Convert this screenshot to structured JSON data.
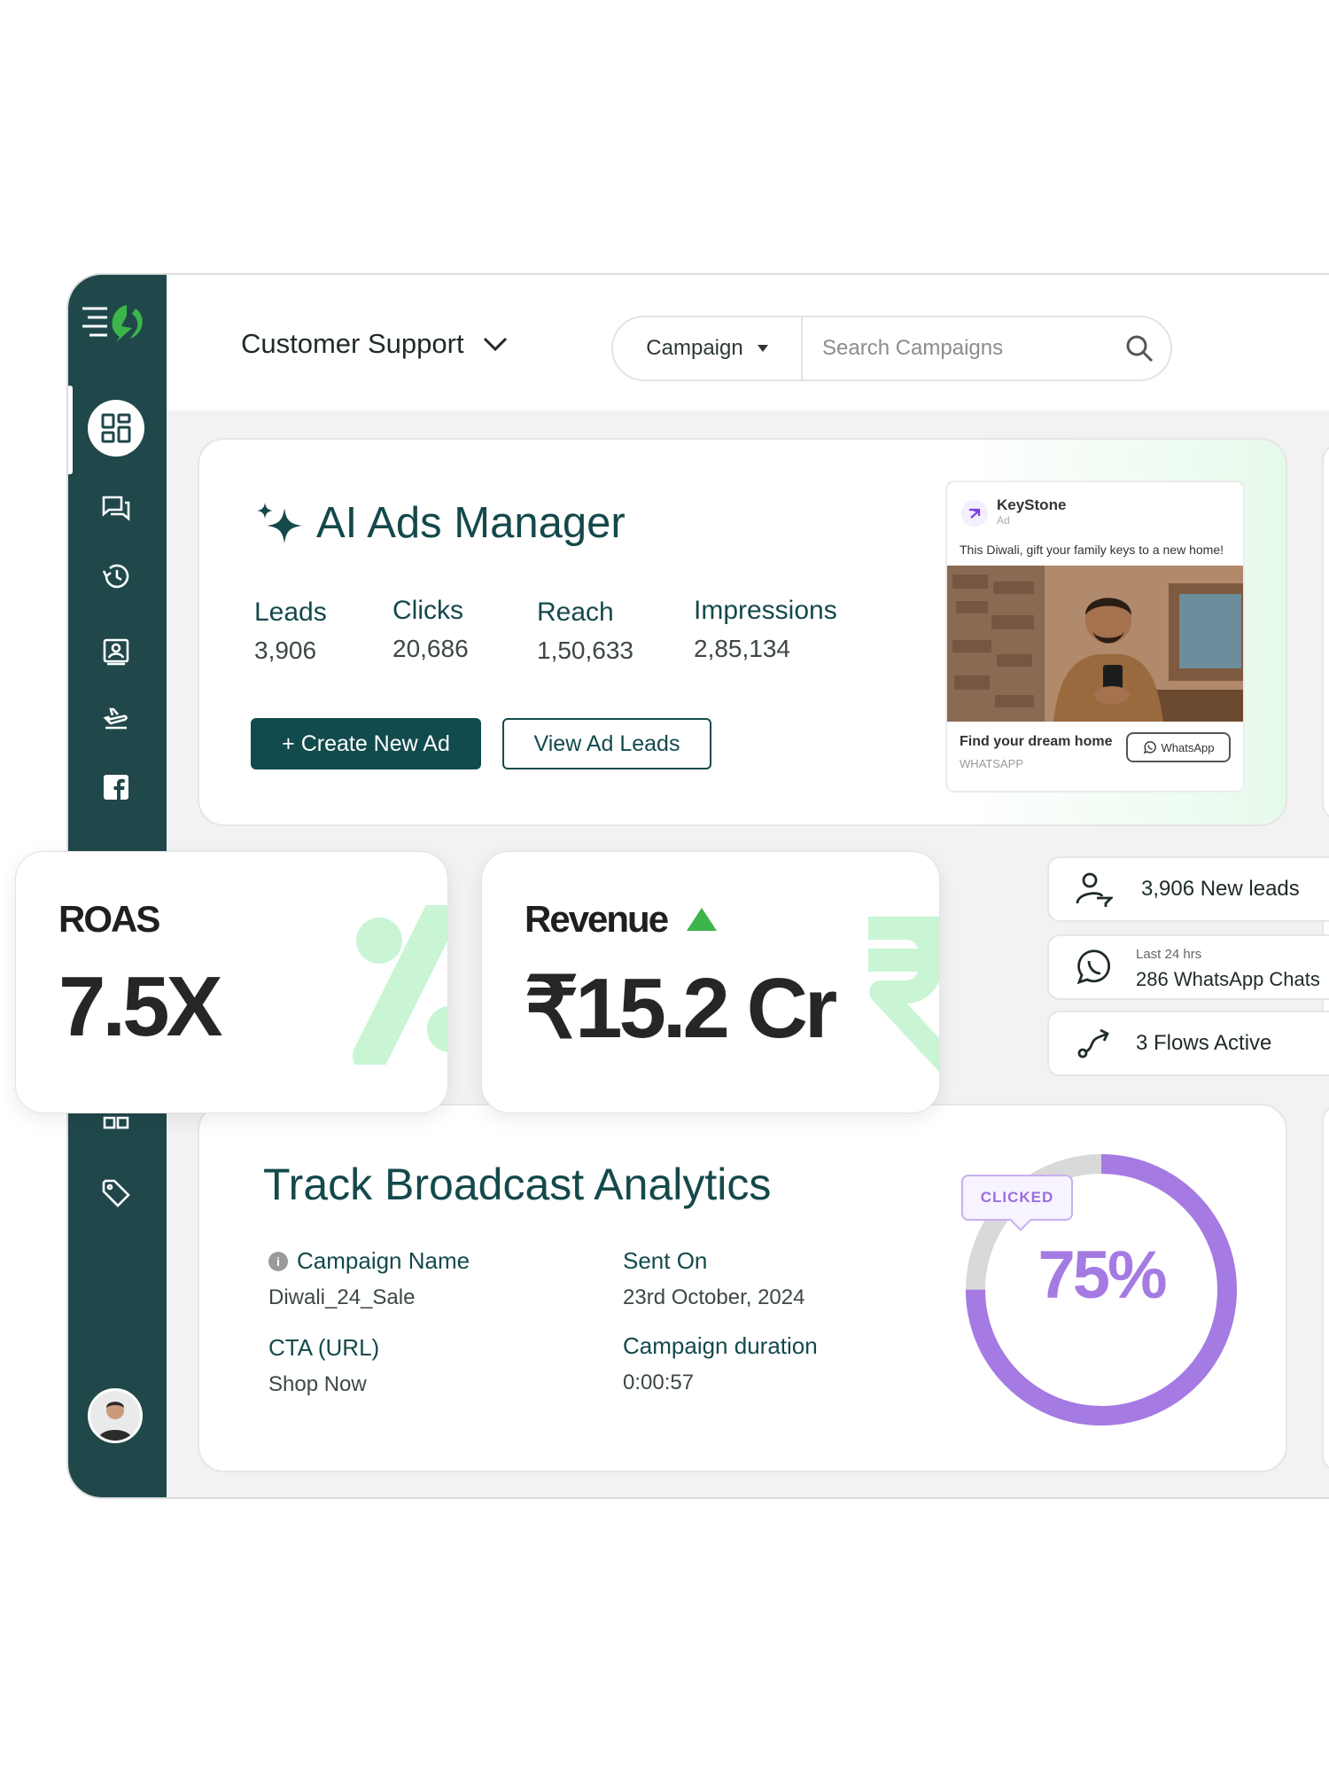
{
  "topbar": {
    "workspace": "Customer Support",
    "campaign_select": "Campaign",
    "search_placeholder": "Search Campaigns"
  },
  "sidebar": {
    "items": [
      {
        "icon": "dashboard-icon",
        "active": true
      },
      {
        "icon": "chat-icon"
      },
      {
        "icon": "history-icon"
      },
      {
        "icon": "contacts-icon"
      },
      {
        "icon": "flight-icon"
      },
      {
        "icon": "facebook-icon"
      },
      {
        "icon": "grid-icon"
      },
      {
        "icon": "tag-icon"
      }
    ]
  },
  "ads_manager": {
    "title": "AI Ads Manager",
    "metrics": [
      {
        "label": "Leads",
        "value": "3,906"
      },
      {
        "label": "Clicks",
        "value": "20,686"
      },
      {
        "label": "Reach",
        "value": "1,50,633"
      },
      {
        "label": "Impressions",
        "value": "2,85,134"
      }
    ],
    "create_button": "+ Create New Ad",
    "view_button": "View Ad Leads",
    "ad_preview": {
      "brand": "KeyStone",
      "brand_sub": "Ad",
      "caption": "This Diwali, gift your family keys to a new home!",
      "footer_title": "Find your dream home",
      "footer_sub": "WHATSAPP",
      "cta": "WhatsApp"
    }
  },
  "roas": {
    "label": "ROAS",
    "value": "7.5X"
  },
  "revenue": {
    "label": "Revenue",
    "value": "₹15.2 Cr"
  },
  "side_stats": {
    "leads": "3,906 New leads",
    "chats_sub": "Last 24 hrs",
    "chats": "286 WhatsApp Chats",
    "flows": "3 Flows Active"
  },
  "broadcast": {
    "title": "Track Broadcast Analytics",
    "campaign_name_label": "Campaign Name",
    "campaign_name": "Diwali_24_Sale",
    "sent_on_label": "Sent On",
    "sent_on": "23rd October, 2024",
    "cta_label": "CTA (URL)",
    "cta": "Shop Now",
    "duration_label": "Campaign duration",
    "duration": "0:00:57",
    "clicked_label": "CLICKED",
    "clicked_pct": "75%",
    "clicked_fraction": 0.75
  },
  "colors": {
    "sidebar": "#20484b",
    "primary": "#124b4d",
    "accent_green": "#3cb54a",
    "donut_purple": "#a57ae3",
    "mint": "#c9f5d5"
  }
}
